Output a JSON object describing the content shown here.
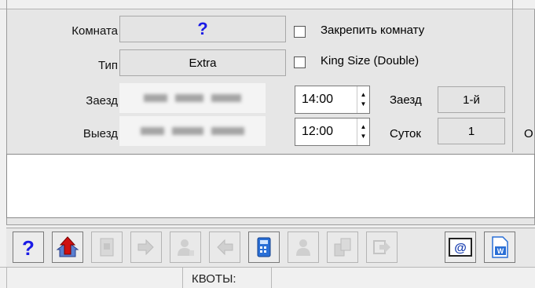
{
  "form": {
    "room_label": "Комната",
    "room_value": "?",
    "type_label": "Тип",
    "type_value": "Extra",
    "checkin_label": "Заезд",
    "checkout_label": "Выезд",
    "checkin_time": "14:00",
    "checkout_time": "12:00",
    "pin_room_label": "Закрепить комнату",
    "king_size_label": "King Size (Double)",
    "arrival_label": "Заезд",
    "arrival_value": "1-й",
    "nights_label": "Суток",
    "nights_value": "1",
    "cut_label": "О"
  },
  "bottom": {
    "tab_text": "КВОТЫ:"
  },
  "toolbar": {
    "buttons": [
      "help-icon",
      "house-arrow-icon",
      "document-disabled-icon",
      "arrow-right-disabled-icon",
      "person-disabled-icon",
      "arrow-left-disabled-icon",
      "calculator-icon",
      "person2-disabled-icon",
      "copy-disabled-icon",
      "arrow-out-disabled-icon",
      "email-icon",
      "word-icon"
    ]
  },
  "colors": {
    "question_blue": "#1a1ae6",
    "calc_blue": "#2a6fd6",
    "red_arrow": "#d01010"
  }
}
